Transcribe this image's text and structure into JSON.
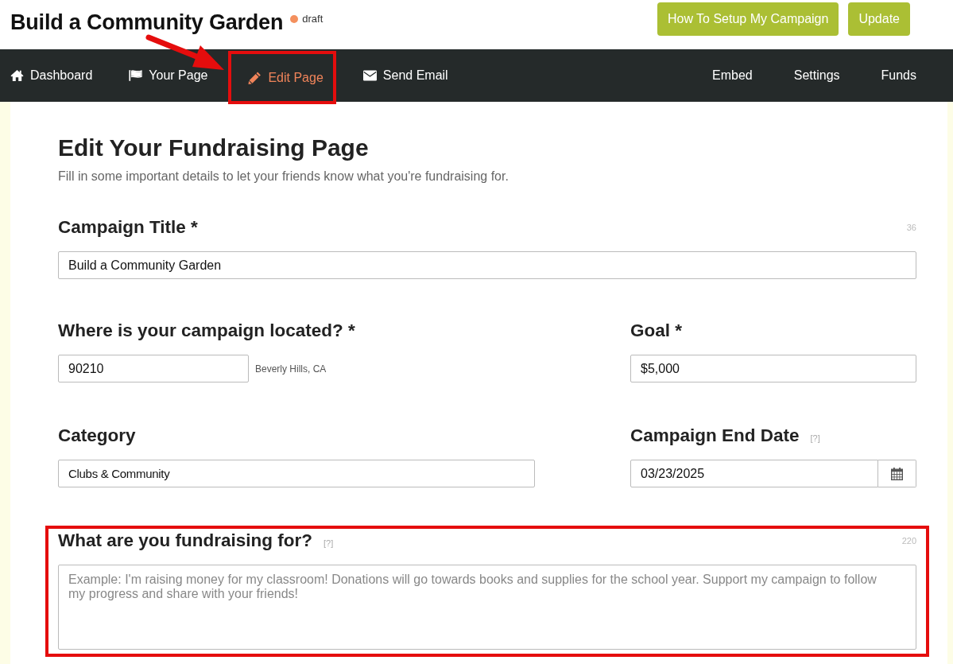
{
  "header": {
    "title": "Build a Community Garden",
    "status": "draft",
    "buttons": [
      {
        "label": "How To Setup My Campaign"
      },
      {
        "label": "Update"
      }
    ]
  },
  "nav": {
    "items": [
      {
        "label": "Dashboard",
        "selected": false,
        "highlighted": false
      },
      {
        "label": "Your Page",
        "selected": false,
        "highlighted": false
      },
      {
        "label": "Edit Page",
        "selected": true,
        "highlighted": true
      },
      {
        "label": "Send Email",
        "selected": false,
        "highlighted": false
      }
    ],
    "right_items": [
      {
        "label": "Embed",
        "selected": false
      },
      {
        "label": "Settings",
        "selected": false
      },
      {
        "label": "Funds",
        "selected": false
      }
    ]
  },
  "page": {
    "title": "Edit Your Fundraising Page",
    "subtitle": "Fill in some important details to let your friends know what you're fundraising for."
  },
  "form": {
    "rows": [
      {
        "fields": [
          {
            "kind": "text",
            "label": "Campaign Title *",
            "counter": "36",
            "value": "Build a Community Garden",
            "highlighted": false
          }
        ]
      },
      {
        "fields": [
          {
            "kind": "text",
            "label": "Where is your campaign located? *",
            "value": "90210",
            "hint": "Beverly Hills, CA",
            "highlighted": false
          },
          {
            "kind": "text",
            "label": "Goal *",
            "value": "$5,000",
            "highlighted": false
          }
        ]
      },
      {
        "fields": [
          {
            "kind": "select",
            "label": "Category",
            "value": "Clubs & Community",
            "highlighted": false
          },
          {
            "kind": "date",
            "label": "Campaign End Date",
            "help": "[?]",
            "value": "03/23/2025",
            "highlighted": false
          }
        ]
      },
      {
        "fields": [
          {
            "kind": "textarea",
            "label": "What are you fundraising for?",
            "help": "[?]",
            "counter": "220",
            "placeholder": "Example: I'm raising money for my classroom! Donations will go towards books and supplies for the school year. Support my campaign to follow my progress and share with your friends!",
            "highlighted": true
          }
        ]
      }
    ]
  }
}
